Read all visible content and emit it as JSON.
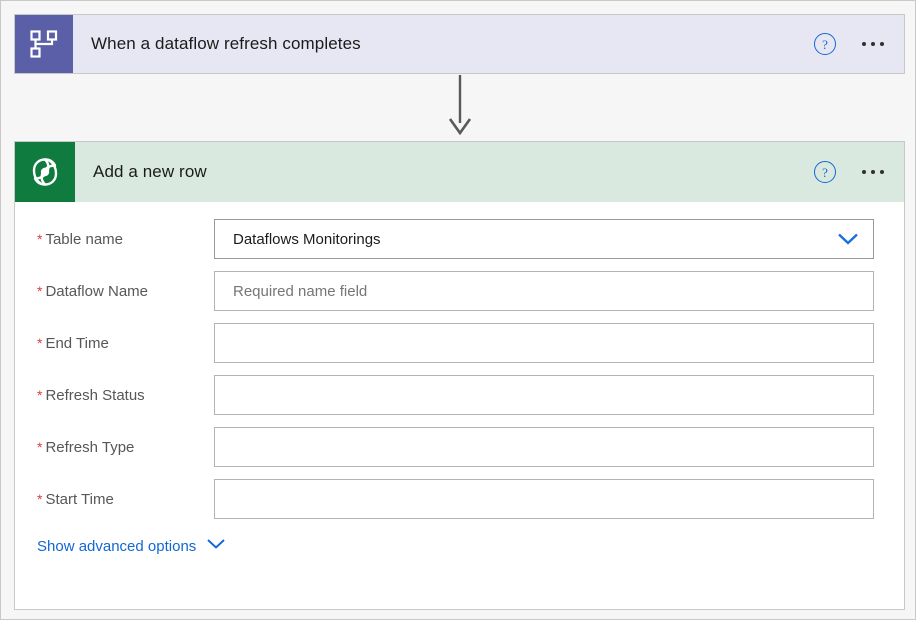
{
  "colors": {
    "trigger_header_bg": "#e7e7f4",
    "trigger_icon_bg": "#5b5fa7",
    "action_header_bg": "#d9e9e0",
    "action_icon_bg": "#0f7b3e",
    "accent_link": "#1268d3",
    "required_star": "#d8413a",
    "page_bg": "#f6f6f6",
    "arrow": "#595959"
  },
  "trigger": {
    "title": "When a dataflow refresh completes",
    "icon": "dataflow-hierarchy-icon",
    "help_glyph": "?",
    "menu_glyph": "..."
  },
  "action": {
    "title": "Add a new row",
    "icon": "dataverse-icon",
    "help_glyph": "?",
    "menu_glyph": "...",
    "fields": [
      {
        "label": "Table name",
        "required_marker": "*",
        "value": "Dataflows Monitorings",
        "placeholder": "",
        "type": "dropdown"
      },
      {
        "label": "Dataflow Name",
        "required_marker": "*",
        "value": "",
        "placeholder": "Required name field",
        "type": "text"
      },
      {
        "label": "End Time",
        "required_marker": "*",
        "value": "",
        "placeholder": "",
        "type": "text"
      },
      {
        "label": "Refresh Status",
        "required_marker": "*",
        "value": "",
        "placeholder": "",
        "type": "text"
      },
      {
        "label": "Refresh Type",
        "required_marker": "*",
        "value": "",
        "placeholder": "",
        "type": "text"
      },
      {
        "label": "Start Time",
        "required_marker": "*",
        "value": "",
        "placeholder": "",
        "type": "text"
      }
    ],
    "advanced_options": {
      "label": "Show advanced options",
      "chevron": "chevron-down-icon"
    }
  },
  "connector": {
    "icon": "arrow-down-icon"
  }
}
